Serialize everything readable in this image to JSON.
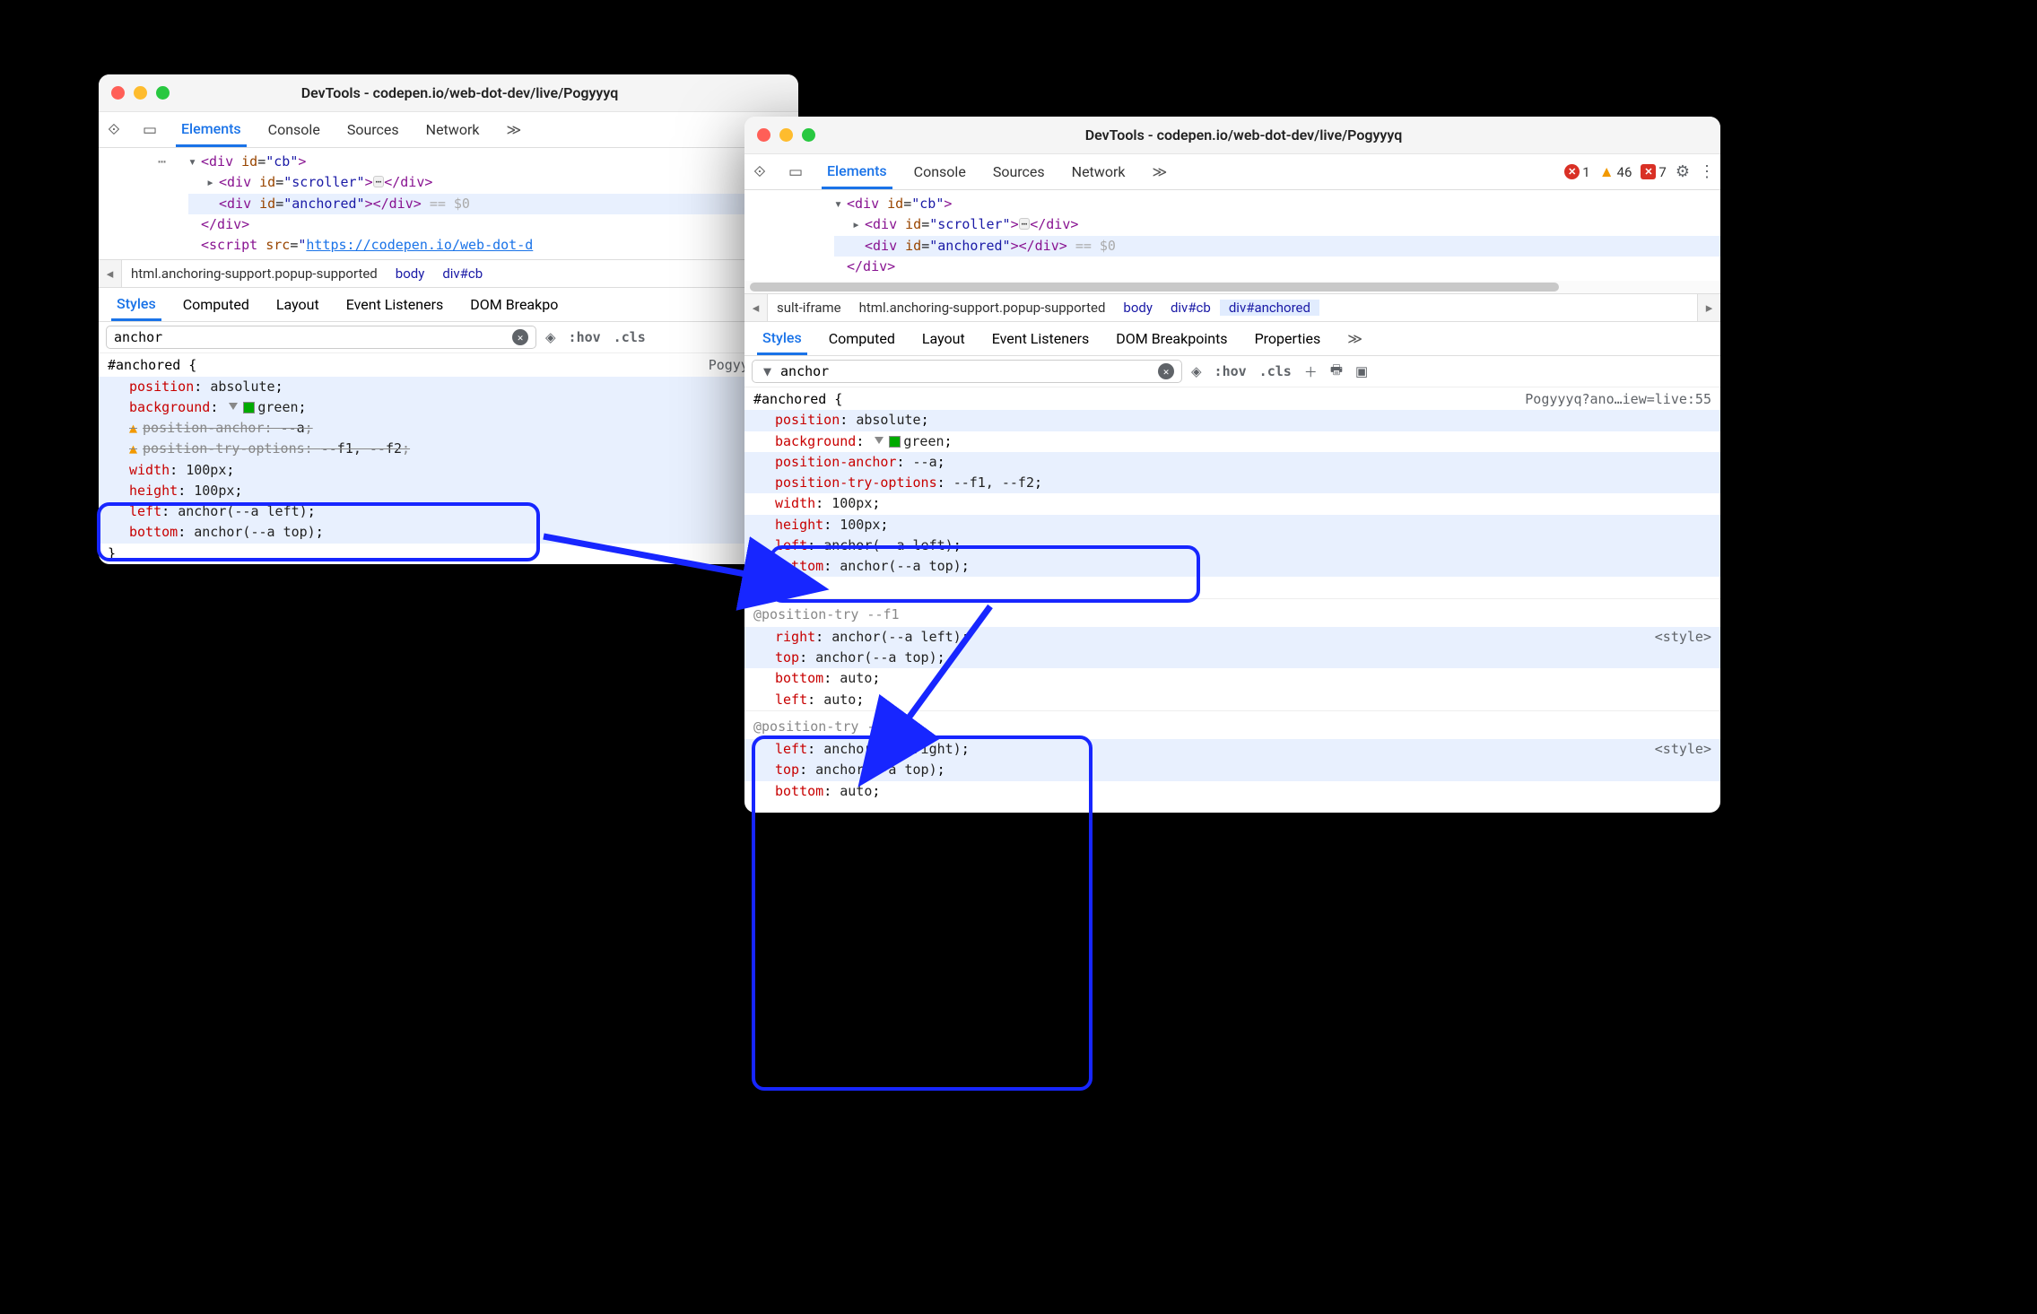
{
  "win1": {
    "title": "DevTools - codepen.io/web-dot-dev/live/Pogyyyq",
    "tabs": [
      "Elements",
      "Console",
      "Sources",
      "Network"
    ],
    "tabs_more": "≫",
    "dom": {
      "l1": "▾<div id=\"cb\">",
      "l2": "▸<div id=\"scroller\">…</div>",
      "l3": "<div id=\"anchored\"></div> == $0",
      "l4": "</div>",
      "l5": "<script src=\"https://codepen.io/web-dot-d…"
    },
    "crumbs": [
      "html.anchoring-support.popup-supported",
      "body",
      "div#cb"
    ],
    "styletabs": [
      "Styles",
      "Computed",
      "Layout",
      "Event Listeners",
      "DOM Breakpo"
    ],
    "filter": "anchor",
    "hov": ":hov",
    "cls": ".cls",
    "rule_source": "Pogyyyq?an",
    "selector": "#anchored {",
    "props": {
      "position": "position",
      "position_v": "absolute",
      "background": "background",
      "background_v": "green",
      "pos_anchor": "position-anchor",
      "pos_anchor_v": "--a",
      "pos_try": "position-try-options",
      "pos_try_v": "--f1, --f2",
      "width": "width",
      "width_v": "100px",
      "height": "height",
      "height_v": "100px",
      "left": "left",
      "left_v": "anchor(--a left)",
      "bottom": "bottom",
      "bottom_v": "anchor(--a top)"
    }
  },
  "win2": {
    "title": "DevTools - codepen.io/web-dot-dev/live/Pogyyyq",
    "tabs": [
      "Elements",
      "Console",
      "Sources",
      "Network"
    ],
    "tabs_more": "≫",
    "err_n": "1",
    "warn_n": "46",
    "msg_n": "7",
    "dom": {
      "l1": "▾<div id=\"cb\">",
      "l2": "▸<div id=\"scroller\">…</div>",
      "l3": "<div id=\"anchored\"></div> == $0",
      "l4": "</div>"
    },
    "crumbs_pre": "sult-iframe",
    "crumbs": [
      "html.anchoring-support.popup-supported",
      "body",
      "div#cb",
      "div#anchored"
    ],
    "styletabs": [
      "Styles",
      "Computed",
      "Layout",
      "Event Listeners",
      "DOM Breakpoints",
      "Properties"
    ],
    "filter": "anchor",
    "hov": ":hov",
    "cls": ".cls",
    "rule_source": "Pogyyyq?ano…iew=live:55",
    "selector": "#anchored {",
    "props": {
      "position": "position",
      "position_v": "absolute",
      "background": "background",
      "background_v": "green",
      "pos_anchor": "position-anchor",
      "pos_anchor_v": "--a",
      "pos_try": "position-try-options",
      "pos_try_v": "--f1, --f2",
      "width": "width",
      "width_v": "100px",
      "height": "height",
      "height_v": "100px",
      "left": "left",
      "left_v": "anchor(--a left)",
      "bottom": "bottom",
      "bottom_v": "anchor(--a top)"
    },
    "try1_head": "@position-try --f1",
    "try1": {
      "right": "right",
      "right_v": "anchor(--a left)",
      "top": "top",
      "top_v": "anchor(--a top)",
      "bottom": "bottom",
      "bottom_v": "auto",
      "left": "left",
      "left_v": "auto"
    },
    "try2_head": "@position-try --f2",
    "try2": {
      "left": "left",
      "left_v": "anchor(--a right)",
      "top": "top",
      "top_v": "anchor(--a top)",
      "bottom": "bottom",
      "bottom_v": "auto"
    },
    "stylelnk": "<style>"
  }
}
